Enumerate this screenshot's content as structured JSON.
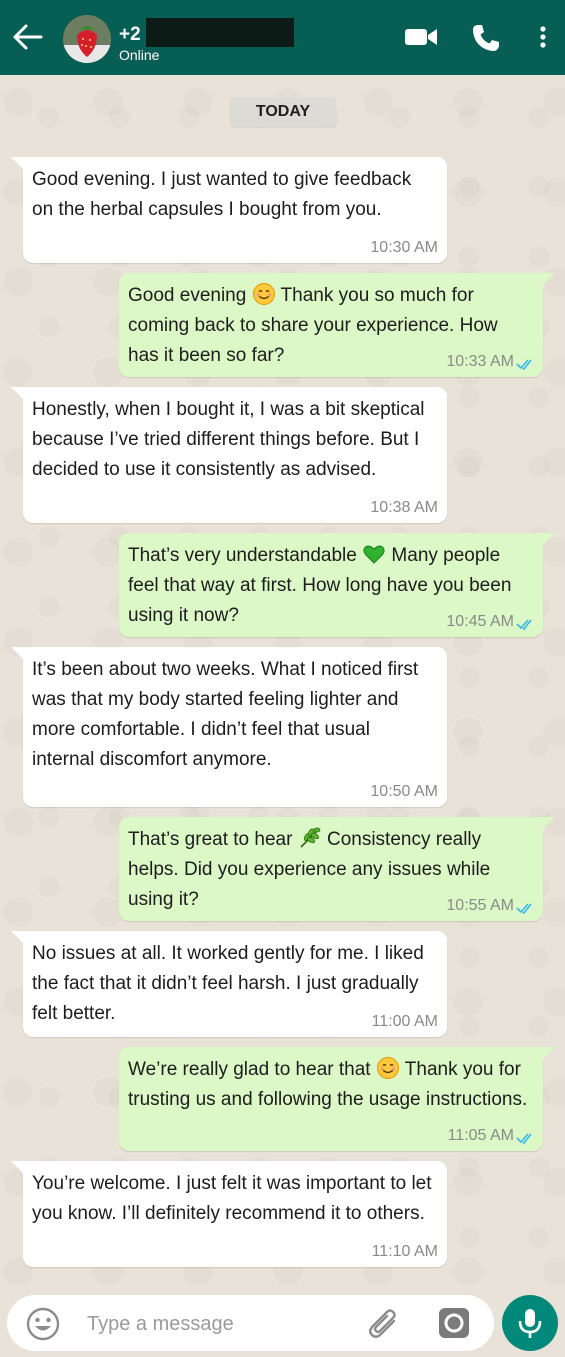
{
  "header": {
    "contact_name": "+2",
    "status": "Online",
    "accent_color": "#075e54",
    "icons": [
      "back-arrow-icon",
      "video-call-icon",
      "voice-call-icon",
      "more-options-icon"
    ]
  },
  "chat": {
    "date_label": "TODAY",
    "messages": [
      {
        "dir": "in",
        "text": "Good evening. I just wanted to give feedback on the herbal capsules I bought from you.",
        "time": "10:30 AM"
      },
      {
        "dir": "out",
        "text_a": "Good evening",
        "emoji": "smiling-face-emoji",
        "text_b": "Thank you so much for coming back to share your experience. How has it been so far?",
        "time": "10:33 AM",
        "read": true
      },
      {
        "dir": "in",
        "text": "Honestly, when I bought it, I was a bit skeptical because I’ve tried different things before. But I decided to use it consistently as advised.",
        "time": "10:38 AM"
      },
      {
        "dir": "out",
        "text_a": "That’s very understandable",
        "emoji": "green-heart-emoji",
        "text_b": "Many people feel that way at first. How long have you been using it now?",
        "time": "10:45 AM",
        "read": true
      },
      {
        "dir": "in",
        "text": "It’s been about two weeks. What I noticed first was that my body started feeling lighter and more comfortable. I didn’t feel that usual internal discomfort anymore.",
        "time": "10:50 AM"
      },
      {
        "dir": "out",
        "text_a": "That’s great to hear",
        "emoji": "herb-emoji",
        "text_b": "Consistency really helps. Did you experience any issues while using it?",
        "time": "10:55 AM",
        "read": true
      },
      {
        "dir": "in",
        "text": "No issues at all. It worked gently for me. I liked the fact that it didn’t feel harsh. I just gradually felt better.",
        "time": "11:00 AM"
      },
      {
        "dir": "out",
        "text_a": "We’re really glad to hear that",
        "emoji": "smiling-face-emoji",
        "text_b": "Thank you for trusting us and following the usage instructions.",
        "time": "11:05 AM",
        "read": true
      },
      {
        "dir": "in",
        "text": "You’re welcome. I just felt it was important to let you know. I’ll definitely recommend it to others.",
        "time": "11:10 AM"
      }
    ]
  },
  "footer": {
    "placeholder": "Type a message",
    "mic_color": "#00897b"
  }
}
